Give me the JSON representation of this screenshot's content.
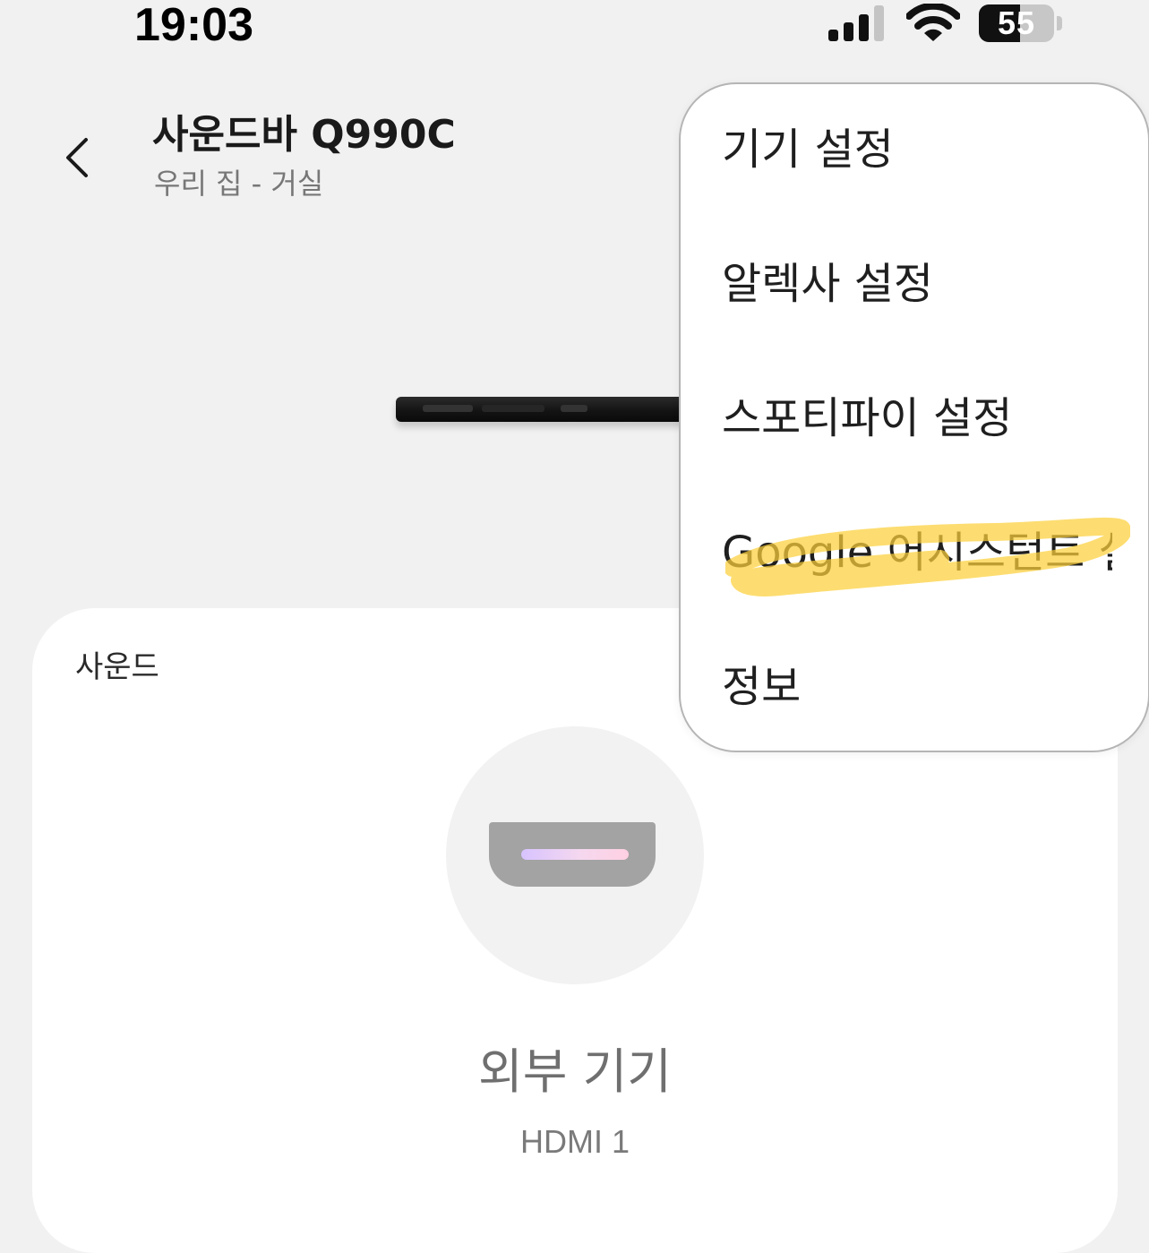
{
  "status_bar": {
    "time": "19:03",
    "battery_level": "55",
    "battery_fraction": 0.55
  },
  "header": {
    "title": "사운드바 Q990C",
    "subtitle": "우리 집 - 거실"
  },
  "sound_card": {
    "label": "사운드",
    "source_name": "외부 기기",
    "source_detail": "HDMI 1"
  },
  "menu": {
    "items": [
      {
        "label": "기기 설정"
      },
      {
        "label": "알렉사 설정"
      },
      {
        "label": "스포티파이 설정"
      },
      {
        "label": "Google 어시스턴트 설정"
      },
      {
        "label": "정보"
      }
    ]
  },
  "colors": {
    "background": "#f1f1f1",
    "card": "#ffffff",
    "highlight": "#fcd03a"
  },
  "icons": {
    "back": "chevron-left-icon",
    "signal": "cellular-signal-icon",
    "wifi": "wifi-icon",
    "battery": "battery-icon",
    "source": "hdmi-icon"
  }
}
